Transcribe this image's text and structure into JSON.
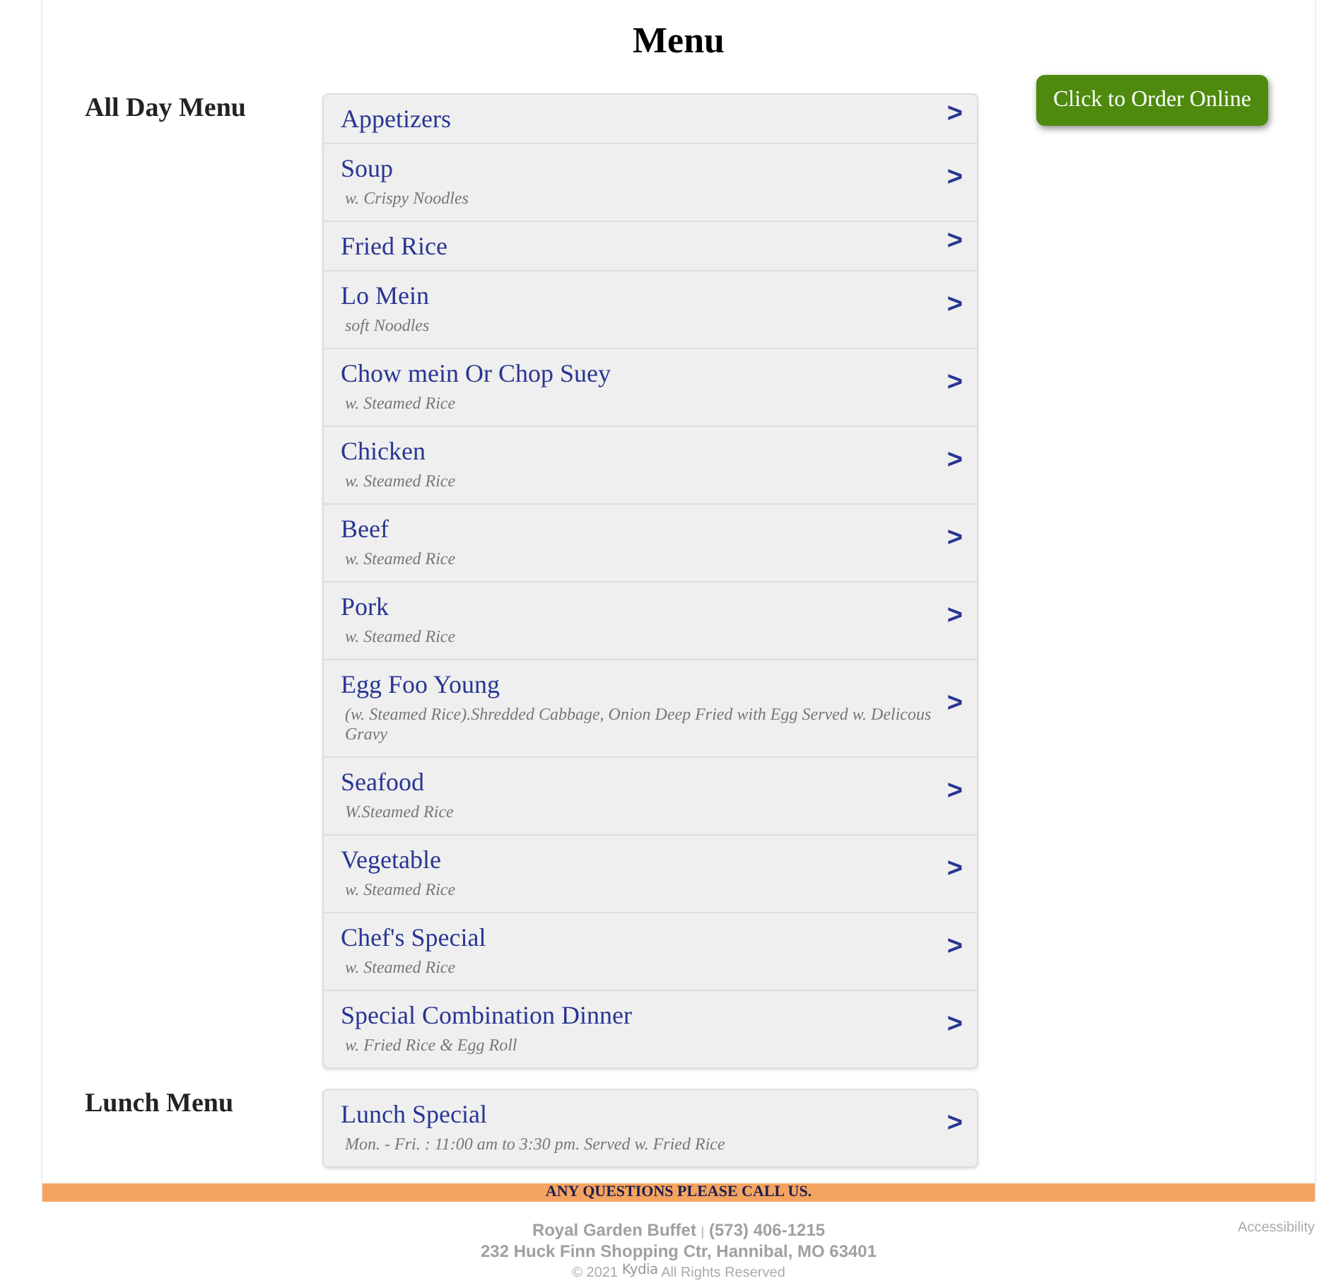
{
  "page": {
    "title": "Menu"
  },
  "order_button": {
    "label": "Click to Order Online"
  },
  "sections": [
    {
      "title": "All Day Menu",
      "items": [
        {
          "name": "Appetizers",
          "arrow": ">"
        },
        {
          "name": "Soup",
          "description": "w. Crispy Noodles",
          "arrow": ">"
        },
        {
          "name": "Fried Rice",
          "arrow": ">"
        },
        {
          "name": "Lo Mein",
          "description": "soft Noodles",
          "arrow": ">"
        },
        {
          "name": "Chow mein Or Chop Suey",
          "description": "w. Steamed Rice",
          "arrow": ">"
        },
        {
          "name": "Chicken",
          "description": "w. Steamed Rice",
          "arrow": ">"
        },
        {
          "name": "Beef",
          "description": "w. Steamed Rice",
          "arrow": ">"
        },
        {
          "name": "Pork",
          "description": "w. Steamed Rice",
          "arrow": ">"
        },
        {
          "name": "Egg Foo Young",
          "description": "(w. Steamed Rice).Shredded Cabbage, Onion Deep Fried with Egg Served w. Delicous Gravy",
          "arrow": ">"
        },
        {
          "name": "Seafood",
          "description": "W.Steamed Rice",
          "arrow": ">"
        },
        {
          "name": "Vegetable",
          "description": "w. Steamed Rice",
          "arrow": ">"
        },
        {
          "name": "Chef's Special",
          "description": "w. Steamed Rice",
          "arrow": ">"
        },
        {
          "name": "Special Combination Dinner",
          "description": "w. Fried Rice & Egg Roll",
          "arrow": ">"
        }
      ]
    },
    {
      "title": "Lunch Menu",
      "items": [
        {
          "name": "Lunch Special",
          "description": "Mon. - Fri. : 11:00 am to 3:30 pm. Served w. Fried Rice",
          "arrow": ">"
        }
      ]
    }
  ],
  "banner": {
    "text": "ANY QUESTIONS PLEASE CALL US."
  },
  "footer": {
    "restaurant": "Royal Garden Buffet",
    "separator": "|",
    "phone": "(573) 406-1215",
    "address": "232 Huck Finn Shopping Ctr, Hannibal, MO 63401",
    "copyright": "© 2021",
    "brand": "Kydia",
    "rights": "All Rights Reserved",
    "accessibility": "Accessibility"
  }
}
